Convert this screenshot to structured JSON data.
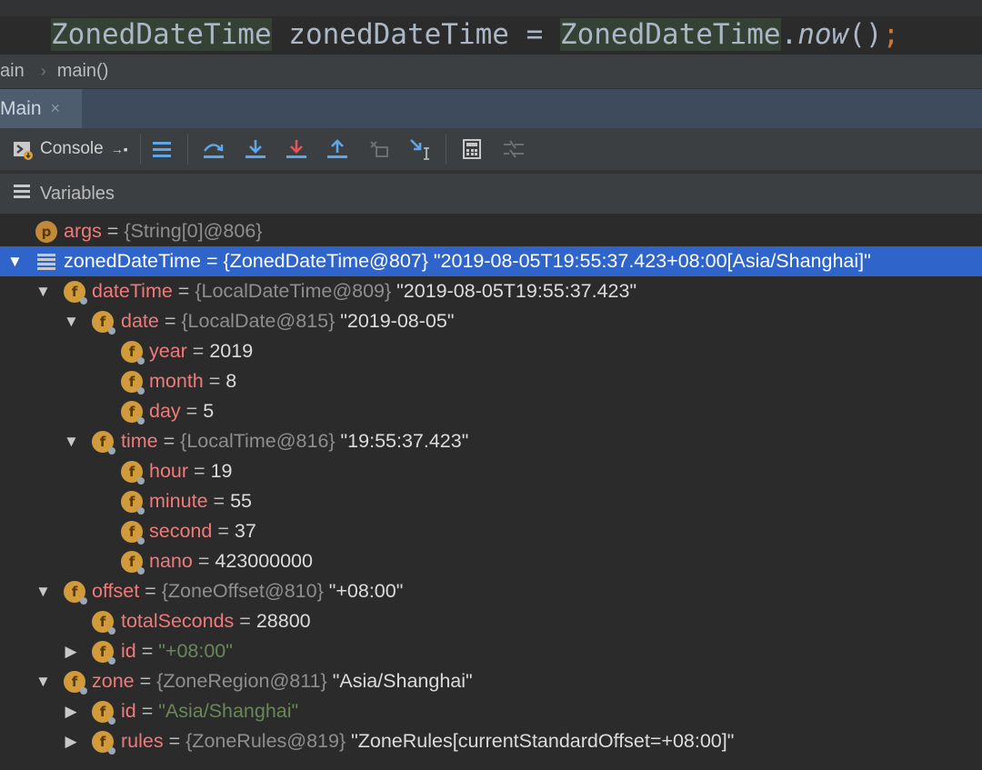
{
  "code": {
    "t1": "ZonedDateTime",
    "t2": " zonedDateTime = ",
    "t3": "ZonedDateTime",
    "t4": ".",
    "t5": "now",
    "t6": "()",
    "t7": ";"
  },
  "breadcrumb": {
    "first": "ain",
    "second": "main()"
  },
  "tab": {
    "label": "Main",
    "close": "×"
  },
  "toolbar": {
    "console_label": "Console"
  },
  "variables": {
    "title": "Variables"
  },
  "colors": {
    "selection": "#2f65ca",
    "field_badge": "#d19a3a",
    "name": "#f07a7a",
    "string": "#6a8759"
  },
  "tree": [
    {
      "name": "args",
      "eq": " = ",
      "ref": "{String[0]@806}",
      "value": ""
    },
    {
      "name": "zonedDateTime",
      "eq": " = ",
      "ref": "{ZonedDateTime@807}",
      "value": " \"2019-08-05T19:55:37.423+08:00[Asia/Shanghai]\""
    },
    {
      "name": "dateTime",
      "eq": " = ",
      "ref": "{LocalDateTime@809}",
      "value": " \"2019-08-05T19:55:37.423\""
    },
    {
      "name": "date",
      "eq": " = ",
      "ref": "{LocalDate@815}",
      "value": " \"2019-08-05\""
    },
    {
      "name": "year",
      "eq": " = ",
      "ref": "",
      "value": "2019"
    },
    {
      "name": "month",
      "eq": " = ",
      "ref": "",
      "value": "8"
    },
    {
      "name": "day",
      "eq": " = ",
      "ref": "",
      "value": "5"
    },
    {
      "name": "time",
      "eq": " = ",
      "ref": "{LocalTime@816}",
      "value": " \"19:55:37.423\""
    },
    {
      "name": "hour",
      "eq": " = ",
      "ref": "",
      "value": "19"
    },
    {
      "name": "minute",
      "eq": " = ",
      "ref": "",
      "value": "55"
    },
    {
      "name": "second",
      "eq": " = ",
      "ref": "",
      "value": "37"
    },
    {
      "name": "nano",
      "eq": " = ",
      "ref": "",
      "value": "423000000"
    },
    {
      "name": "offset",
      "eq": " = ",
      "ref": "{ZoneOffset@810}",
      "value": " \"+08:00\""
    },
    {
      "name": "totalSeconds",
      "eq": " = ",
      "ref": "",
      "value": "28800"
    },
    {
      "name": "id",
      "eq": " = ",
      "ref": "",
      "value": "\"+08:00\""
    },
    {
      "name": "zone",
      "eq": " = ",
      "ref": "{ZoneRegion@811}",
      "value": " \"Asia/Shanghai\""
    },
    {
      "name": "id",
      "eq": " = ",
      "ref": "",
      "value": "\"Asia/Shanghai\""
    },
    {
      "name": "rules",
      "eq": " = ",
      "ref": "{ZoneRules@819}",
      "value": " \"ZoneRules[currentStandardOffset=+08:00]\""
    }
  ],
  "badges": {
    "param": "p",
    "field": "f"
  },
  "arrows": {
    "expanded": "▼",
    "collapsed": "▶"
  }
}
